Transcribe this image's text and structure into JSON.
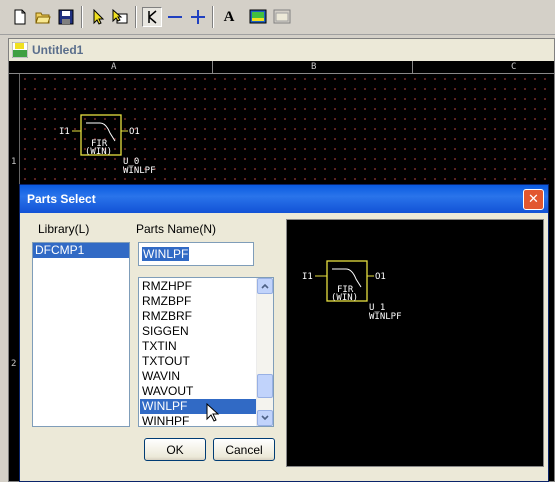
{
  "toolbar": {
    "buttons": [
      {
        "name": "new-file-icon"
      },
      {
        "name": "open-folder-icon"
      },
      {
        "name": "save-icon"
      },
      {
        "name": "select-arrow-icon"
      },
      {
        "name": "select-parts-icon"
      },
      {
        "name": "line-tool-icon"
      },
      {
        "name": "horizontal-line-icon"
      },
      {
        "name": "junction-icon"
      },
      {
        "name": "text-icon",
        "glyph": "A"
      },
      {
        "name": "image-icon"
      },
      {
        "name": "dialog-icon"
      }
    ]
  },
  "document": {
    "icon_text": "D SP",
    "title": "Untitled1",
    "columns": [
      "A",
      "B",
      "C"
    ],
    "rows": [
      "1",
      "2"
    ],
    "symbol": {
      "input": "I1",
      "output": "O1",
      "body_line1": "FIR",
      "body_line2": "(WIN)",
      "instance": "U_0",
      "part": "WINLPF"
    }
  },
  "dialog": {
    "title": "Parts Select",
    "close_glyph": "✕",
    "library_label": "Library(L)",
    "parts_name_label": "Parts Name(N)",
    "libraries": [
      "DFCMP1"
    ],
    "selected_library": "DFCMP1",
    "parts_name_value": "WINLPF",
    "parts": [
      "RMZHPF",
      "RMZBPF",
      "RMZBRF",
      "SIGGEN",
      "TXTIN",
      "TXTOUT",
      "WAVIN",
      "WAVOUT",
      "WINLPF",
      "WINHPF"
    ],
    "selected_part": "WINLPF",
    "ok_label": "OK",
    "cancel_label": "Cancel",
    "preview": {
      "input": "I1",
      "output": "O1",
      "body_line1": "FIR",
      "body_line2": "(WIN)",
      "instance": "U_1",
      "part": "WINLPF"
    }
  },
  "colors": {
    "symbol": "#e8e040",
    "symbol_text": "#ffffff",
    "selection": "#316ac5",
    "grid_dot": "#7a2a2a"
  }
}
